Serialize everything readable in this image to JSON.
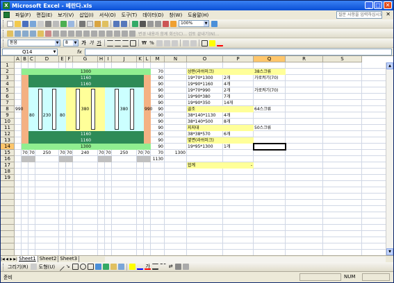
{
  "app": {
    "title": "Microsoft Excel - 베란다.xls",
    "app_icon": "X"
  },
  "menu": {
    "items": [
      "파일(F)",
      "편집(E)",
      "보기(V)",
      "삽입(I)",
      "서식(O)",
      "도구(T)",
      "데이터(D)",
      "창(W)",
      "도움말(H)"
    ],
    "help_placeholder": "질문 사항을 입력하십시오."
  },
  "toolbar": {
    "zoom": "100%",
    "review_text": "변경 내용과 함께 회신(C)... 검토 끝내기(N)...",
    "font_name": "돋움",
    "font_size": "8",
    "currency": "₩",
    "percent": "%"
  },
  "formula": {
    "cell_ref": "Q14",
    "fx": "fx",
    "value": ""
  },
  "columns": [
    "A",
    "B",
    "C",
    "D",
    "E",
    "F",
    "G",
    "H",
    "I",
    "J",
    "K",
    "L",
    "M",
    "N",
    "O",
    "P",
    "Q",
    "R",
    "S"
  ],
  "rows": [
    "1",
    "2",
    "3",
    "4",
    "5",
    "6",
    "7",
    "8",
    "9",
    "10",
    "11",
    "12",
    "13",
    "14",
    "15",
    "16",
    "17",
    "18",
    "19"
  ],
  "selected": {
    "column": "Q",
    "row": "14"
  },
  "drawing": {
    "bar1": "1300",
    "bar2": "1160",
    "bar3": "1160",
    "bar4": "1160",
    "bar5": "1160",
    "bar6": "1300",
    "left_height": "990",
    "right_height": "990",
    "inner_widths": [
      "80",
      "230",
      "80",
      "380",
      "380"
    ],
    "bottom_dims": [
      "70",
      "70",
      "250",
      "70",
      "70",
      "240",
      "70",
      "70",
      "250",
      "70",
      "70"
    ],
    "total_width": "1130",
    "side_width": "1300"
  },
  "m_column": [
    "70",
    "90",
    "90",
    "90",
    "90",
    "90",
    "90",
    "90",
    "90",
    "90",
    "90",
    "90",
    "90",
    "70",
    "1300"
  ],
  "materials": {
    "header1": "상판(라쉬미크)",
    "header1_note": "38스크류",
    "items1": [
      {
        "spec": "19*70*1300",
        "qty": "2개",
        "note": ""
      },
      {
        "spec": "19*90*1160",
        "qty": "4개",
        "note": ""
      },
      {
        "spec": "19*70*990",
        "qty": "2개",
        "note": "가로켜기(70)"
      },
      {
        "spec": "19*90*380",
        "qty": "7개",
        "note": ""
      },
      {
        "spec": "19*90*350",
        "qty": "14개",
        "note": ""
      }
    ],
    "header2": "골조",
    "header2_note": "64스크류",
    "items2": [
      {
        "spec": "38*140*1130",
        "qty": "4개"
      },
      {
        "spec": "38*140*500",
        "qty": "8개"
      }
    ],
    "header3": "지지대",
    "header3_note": "50스크류",
    "items3": [
      {
        "spec": "38*38*570",
        "qty": "6개"
      }
    ],
    "header4": "옆면(라쉬미크)",
    "items4": [
      {
        "spec": "19*95*1300",
        "qty": "1개"
      }
    ],
    "total_label": "합계",
    "total_value": "-",
    "note_first_row": "가로켜기(70)"
  },
  "sheets": [
    "Sheet1",
    "Sheet2",
    "Sheet3"
  ],
  "drawbar": {
    "draw_label": "그리기(R)",
    "shapes_label": "도형(U)"
  },
  "status": {
    "ready": "준비",
    "num": "NUM"
  },
  "colors": {
    "dark_green": "#2e8b57",
    "light_green": "#90ee90",
    "cyan": "#ccffff",
    "yellow": "#ffff99",
    "orange": "#f4b183",
    "gray": "#c0c0c0"
  }
}
